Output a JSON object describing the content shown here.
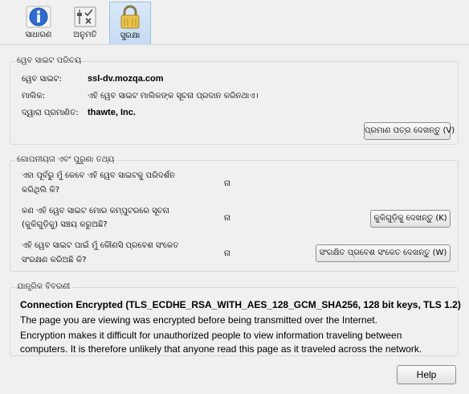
{
  "tabs": [
    {
      "label": "ସାଧାରଣ",
      "icon": "info-icon"
    },
    {
      "label": "ଅନୁମତି",
      "icon": "permissions-icon"
    },
    {
      "label": "ସୁରକ୍ଷା",
      "icon": "lock-icon"
    }
  ],
  "website_identity": {
    "legend": "ୱେବ ସାଇଟ ପରିଚୟ",
    "website_label": "ୱେବ ସାଇଟ:",
    "website_value": "ssl-dv.mozqa.com",
    "owner_label": "ମାଲିକ:",
    "owner_value": "ଏହି ୱେବ ସାଇଟ ମାଲିକଙ୍କ ସୂଚନା ପ୍ରଦାନ କରିନଥାଏ।",
    "verified_label": "ଦ୍ୱାରା ପ୍ରମାଣିତ:",
    "verified_value": "thawte, Inc.",
    "view_cert_button": "ପ୍ରମାଣ ପତ୍ର ଦେଖନ୍ତୁ (V)"
  },
  "privacy_history": {
    "legend": "ଗୋପନୀୟତା ଏବଂ ପୁରୁଣା ତଥ୍ୟ",
    "q1_line1": "ଏହା ପୂର୍ବରୁ ମୁଁ କେବେ ଏହି ୱେବ ସାଇଟକୁ ପରିଦର୍ଶନ",
    "q1_line2": "କରିଥିଲି କି?",
    "q1_answer": "ନା",
    "q2_line1": "କଣ ଏହି ୱେବ ସାଇଟ ମୋର କମ୍ପୁଟରରେ ସୂଚନା",
    "q2_line2": "(କୁକିଗୁଡ଼ିକୁ) ସଞ୍ଚୟ କରୁଅଛି?",
    "q2_answer": "ନା",
    "q2_button": "କୁକିଗୁଡ଼ିକୁ ଦେଖନ୍ତୁ (K)",
    "q3_line1": "ଏହି ୱେବ ସାଇଟ ପାଇଁ ମୁଁ କୌଣସି ପ୍ରବେଶ ସଂକେତ",
    "q3_line2": "ସଂରକ୍ଷଣ କରିଅଛି କି?",
    "q3_answer": "ନା",
    "q3_button": "ସଂରକ୍ଷିତ ପ୍ରବେଶ ସଂକେତ ଦେଖନ୍ତୁ (W)"
  },
  "technical": {
    "legend": "ଯାନ୍ତ୍ରିକ ବିବରଣୀ",
    "title": "Connection Encrypted (TLS_ECDHE_RSA_WITH_AES_128_GCM_SHA256, 128 bit keys, TLS 1.2)",
    "para1": "The page you are viewing was encrypted before being transmitted over the Internet.",
    "para2": "Encryption makes it difficult for unauthorized people to view information traveling between computers. It is therefore unlikely that anyone read this page as it traveled across the network."
  },
  "help_button": "Help"
}
